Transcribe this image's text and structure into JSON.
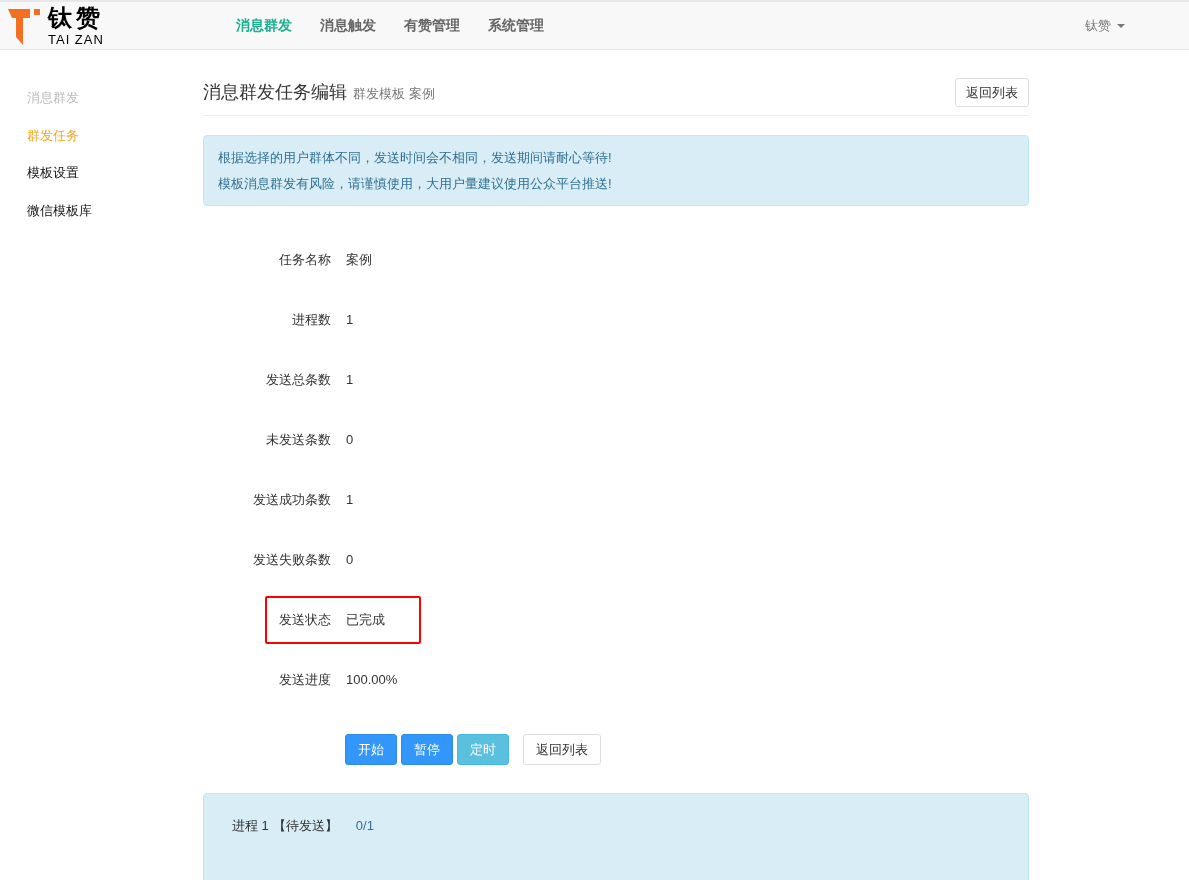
{
  "navbar": {
    "logo": {
      "name": "钛赞",
      "subtitle": "TAI ZAN"
    },
    "items": [
      {
        "label": "消息群发",
        "selected": true
      },
      {
        "label": "消息触发",
        "selected": false
      },
      {
        "label": "有赞管理",
        "selected": false
      },
      {
        "label": "系统管理",
        "selected": false
      }
    ],
    "user_menu": "钛赞"
  },
  "sidebar": {
    "heading": "消息群发",
    "items": [
      {
        "label": "群发任务",
        "selected": true
      },
      {
        "label": "模板设置",
        "selected": false
      },
      {
        "label": "微信模板库",
        "selected": false
      }
    ]
  },
  "page_header": {
    "title": "消息群发任务编辑",
    "subtitle": "群发模板 案例",
    "back_button": "返回列表"
  },
  "notice": [
    "根据选择的用户群体不同，发送时间会不相同，发送期间请耐心等待!",
    "模板消息群发有风险，请谨慎使用，大用户量建议使用公众平台推送!"
  ],
  "fields": [
    {
      "label": "任务名称",
      "value": "案例",
      "highlighted": false
    },
    {
      "label": "进程数",
      "value": "1",
      "highlighted": false
    },
    {
      "label": "发送总条数",
      "value": "1",
      "highlighted": false
    },
    {
      "label": "未发送条数",
      "value": "0",
      "highlighted": false
    },
    {
      "label": "发送成功条数",
      "value": "1",
      "highlighted": false
    },
    {
      "label": "发送失败条数",
      "value": "0",
      "highlighted": false
    },
    {
      "label": "发送状态",
      "value": "已完成",
      "highlighted": true
    },
    {
      "label": "发送进度",
      "value": "100.00%",
      "highlighted": false
    }
  ],
  "actions": [
    {
      "label": "开始",
      "kind": "primary"
    },
    {
      "label": "暂停",
      "kind": "primary"
    },
    {
      "label": "定时",
      "kind": "info"
    },
    {
      "label": "返回列表",
      "kind": "default"
    }
  ],
  "processes": [
    {
      "name": "进程 1",
      "status": "【待发送】",
      "count": "0/1"
    }
  ]
}
